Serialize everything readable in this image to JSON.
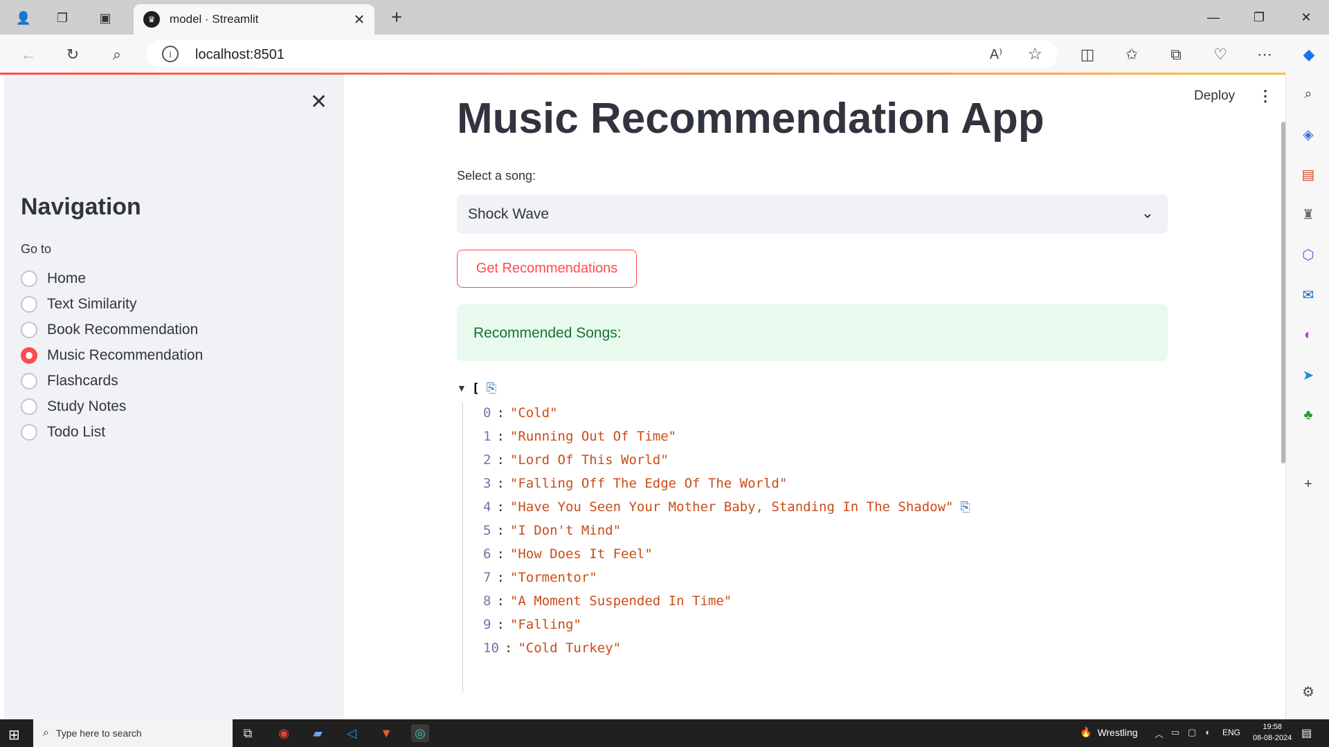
{
  "browser": {
    "tab_title": "model · Streamlit",
    "url": "localhost:8501"
  },
  "sidebar": {
    "heading": "Navigation",
    "goto_label": "Go to",
    "items": [
      {
        "label": "Home",
        "selected": false
      },
      {
        "label": "Text Similarity",
        "selected": false
      },
      {
        "label": "Book Recommendation",
        "selected": false
      },
      {
        "label": "Music Recommendation",
        "selected": true
      },
      {
        "label": "Flashcards",
        "selected": false
      },
      {
        "label": "Study Notes",
        "selected": false
      },
      {
        "label": "Todo List",
        "selected": false
      }
    ]
  },
  "header": {
    "deploy_label": "Deploy"
  },
  "main": {
    "title": "Music Recommendation App",
    "select_label": "Select a song:",
    "select_value": "Shock Wave",
    "button_label": "Get Recommendations",
    "success_text": "Recommended Songs:",
    "json_open": "[",
    "songs": [
      {
        "idx": "0",
        "value": "\"Cold\""
      },
      {
        "idx": "1",
        "value": "\"Running Out Of Time\""
      },
      {
        "idx": "2",
        "value": "\"Lord Of This World\""
      },
      {
        "idx": "3",
        "value": "\"Falling Off The Edge Of The World\""
      },
      {
        "idx": "4",
        "value": "\"Have You Seen Your Mother Baby, Standing In The Shadow\""
      },
      {
        "idx": "5",
        "value": "\"I Don't Mind\""
      },
      {
        "idx": "6",
        "value": "\"How Does It Feel\""
      },
      {
        "idx": "7",
        "value": "\"Tormentor\""
      },
      {
        "idx": "8",
        "value": "\"A Moment Suspended In Time\""
      },
      {
        "idx": "9",
        "value": "\"Falling\""
      },
      {
        "idx": "10",
        "value": "\"Cold Turkey\""
      }
    ]
  },
  "taskbar": {
    "search_placeholder": "Type here to search",
    "weather_text": "Wrestling",
    "lang": "ENG",
    "time": "19:58",
    "date": "08-08-2024"
  },
  "colors": {
    "accent": "#ff4b4b",
    "success_bg": "#e8f9ee",
    "success_text": "#177233",
    "json_string": "#cb4b16"
  }
}
